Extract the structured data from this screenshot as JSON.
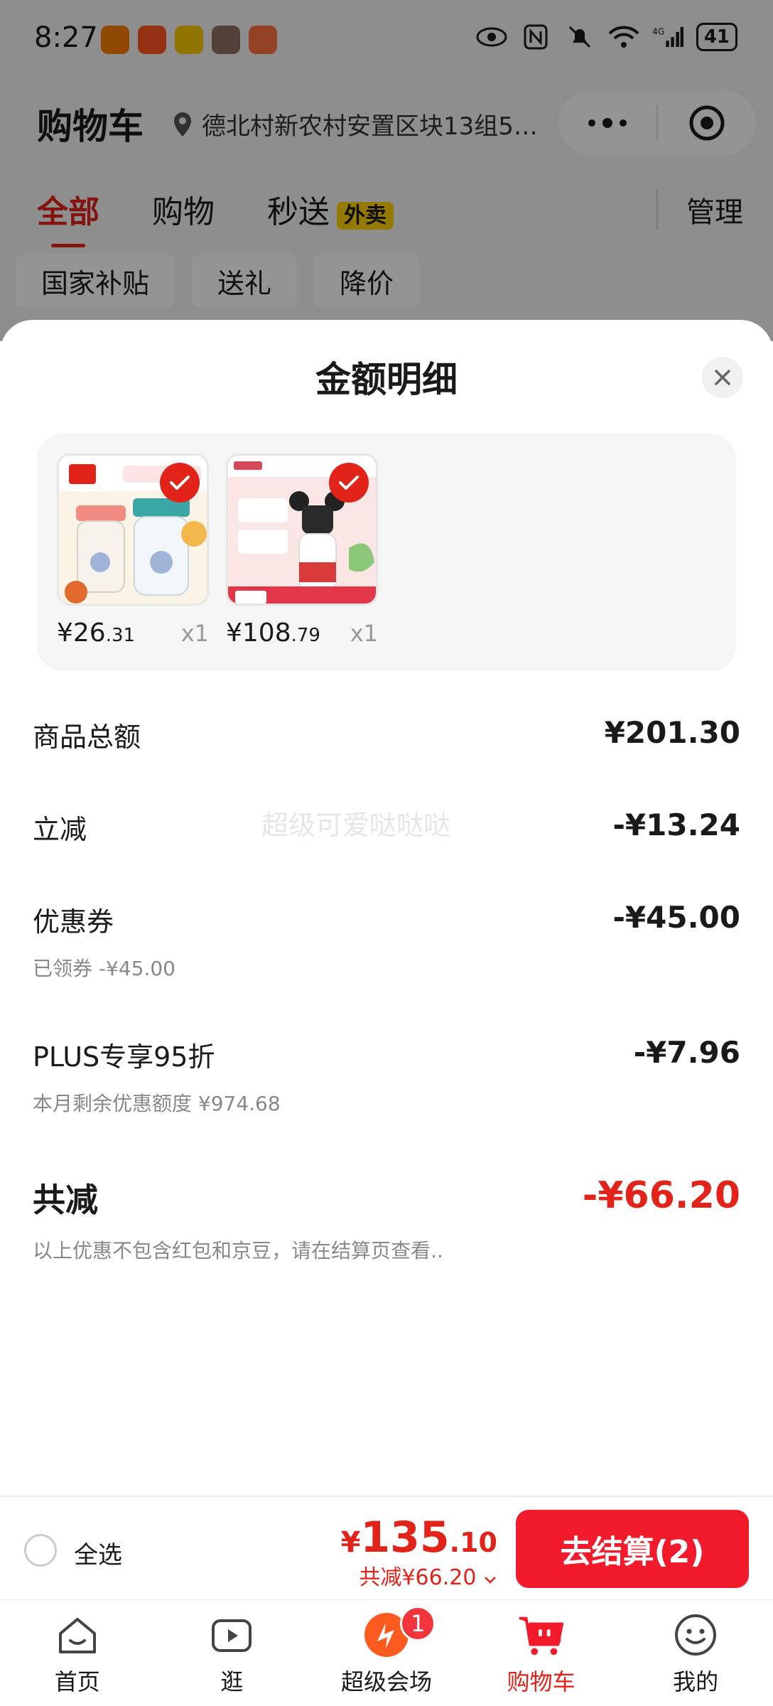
{
  "status_bar": {
    "time": "8:27",
    "network": "4G",
    "battery": "41"
  },
  "header": {
    "title": "购物车",
    "address": "德北村新农村安置区块13组5…"
  },
  "tabs": [
    {
      "label": "全部",
      "active": true
    },
    {
      "label": "购物"
    },
    {
      "label": "秒送",
      "badge": "外卖"
    }
  ],
  "manage_label": "管理",
  "chips": [
    "国家补贴",
    "送礼",
    "降价"
  ],
  "sheet": {
    "title": "金额明细",
    "products": [
      {
        "price_int": "¥26",
        "price_dec": ".31",
        "qty": "x1",
        "checked": true
      },
      {
        "price_int": "¥108",
        "price_dec": ".79",
        "qty": "x1",
        "checked": true
      }
    ],
    "rows": [
      {
        "label": "商品总额",
        "value": "¥201.30"
      },
      {
        "label": "立减",
        "value": "-¥13.24"
      },
      {
        "label": "优惠券",
        "value": "-¥45.00",
        "sub": "已领券 -¥45.00"
      },
      {
        "label": "PLUS专享95折",
        "value": "-¥7.96",
        "sub": "本月剩余优惠额度 ¥974.68"
      }
    ],
    "total": {
      "label": "共减",
      "value": "-¥66.20",
      "note": "以上优惠不包含红包和京豆，请在结算页查看.."
    },
    "watermark": "超级可爱哒哒哒"
  },
  "checkout": {
    "select_all": "全选",
    "price_currency": "¥",
    "price_int": "135",
    "price_dec": ".10",
    "saved": "共减¥66.20",
    "button": "去结算(2)"
  },
  "nav": [
    {
      "label": "首页",
      "icon": "home-icon"
    },
    {
      "label": "逛",
      "icon": "video-icon"
    },
    {
      "label": "超级会场",
      "icon": "super-venue-icon",
      "badge": "1"
    },
    {
      "label": "购物车",
      "icon": "cart-icon",
      "active": true
    },
    {
      "label": "我的",
      "icon": "profile-icon"
    }
  ],
  "colors": {
    "accent": "#e2231a",
    "button": "#f21b2c",
    "waimai_badge": "#ffd400"
  }
}
